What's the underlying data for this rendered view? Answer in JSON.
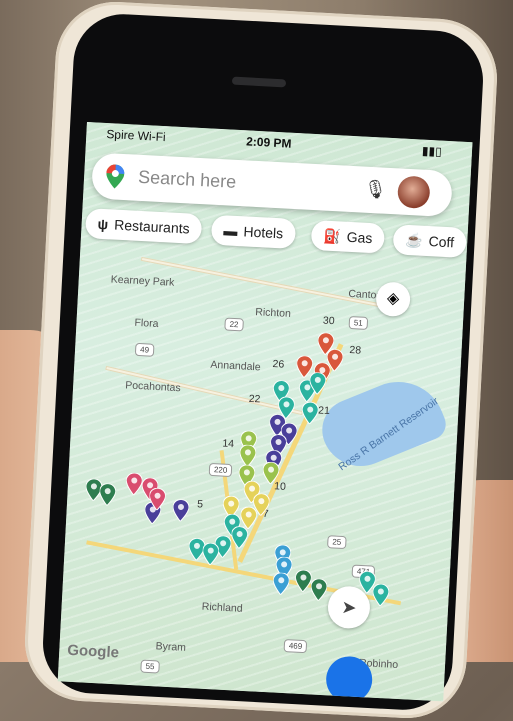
{
  "status_bar": {
    "carrier": "Spire Wi-Fi",
    "time": "2:09 PM"
  },
  "search": {
    "placeholder": "Search here"
  },
  "chips": [
    {
      "label": "Restaurants",
      "icon": "fork-knife-icon"
    },
    {
      "label": "Hotels",
      "icon": "bed-icon"
    },
    {
      "label": "Gas",
      "icon": "gas-pump-icon"
    },
    {
      "label": "Coff",
      "icon": "coffee-icon"
    }
  ],
  "map_labels": {
    "kearney_park": "Kearney Park",
    "canton": "Canton",
    "richton": "Richton",
    "flora": "Flora",
    "annandale": "Annandale",
    "pocahontas": "Pocahontas",
    "reservoir": "Ross R Barnett Reservoir",
    "richland": "Richland",
    "byram": "Byram",
    "robinhood": "Robinho"
  },
  "route_shields": {
    "r22": "22",
    "r51": "51",
    "r49": "49",
    "r220": "220",
    "r25": "25",
    "r471": "471",
    "r469": "469",
    "r55": "55"
  },
  "exit_numbers": {
    "e30": "30",
    "e28": "28",
    "e26": "26",
    "e22": "22",
    "e21": "21",
    "e14": "14",
    "e10": "10",
    "e5": "5",
    "e7": "7"
  },
  "attribution": "Google",
  "colors": {
    "pin_red": "#d9573b",
    "pin_teal": "#2bb3a0",
    "pin_indigo": "#4a3f9a",
    "pin_lime": "#9ac24d",
    "pin_yellow": "#e5d25a",
    "pin_green": "#2e7d4f",
    "pin_pink": "#d94d6f",
    "pin_blue": "#3b9fd4",
    "accent": "#1a73e8"
  }
}
